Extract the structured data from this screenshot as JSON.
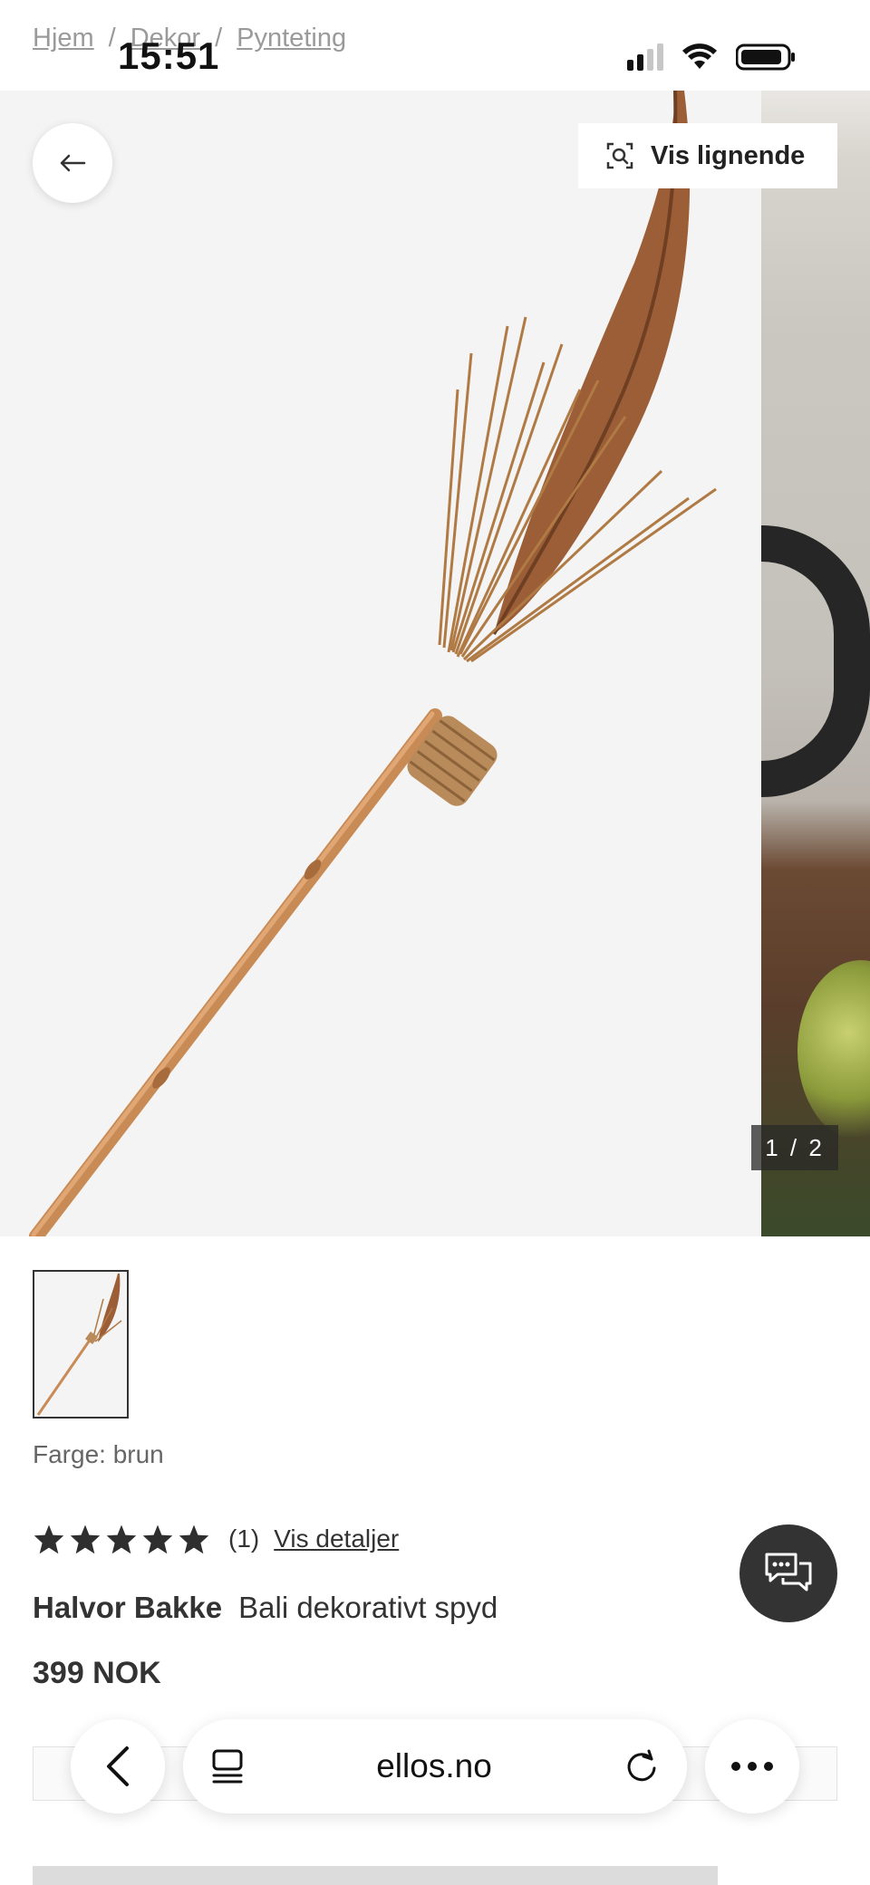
{
  "status_bar": {
    "time": "15:51"
  },
  "breadcrumb": {
    "items": [
      "Hjem",
      "Dekor",
      "Pynteting"
    ],
    "separator": "/"
  },
  "gallery": {
    "back_icon": "arrow-left-icon",
    "similar_button_label": "Vis lignende",
    "similar_icon": "visual-search-icon",
    "counter": "1 / 2"
  },
  "product": {
    "color_label": "Farge: brun",
    "rating_stars": 5,
    "review_count": "(1)",
    "details_link": "Vis detaljer",
    "brand": "Halvor Bakke",
    "name": "Bali dekorativt spyd",
    "price": "399 NOK"
  },
  "chat": {
    "icon": "chat-bubbles-icon"
  },
  "browser": {
    "url": "ellos.no",
    "back_icon": "chevron-left-icon",
    "tabs_icon": "reader-icon",
    "reload_icon": "reload-icon",
    "more_icon": "more-dots-icon"
  },
  "colors": {
    "text": "#2b2b2b",
    "muted": "#9a9a9a",
    "image_bg": "#f4f4f4",
    "chat_bg": "#333333"
  }
}
